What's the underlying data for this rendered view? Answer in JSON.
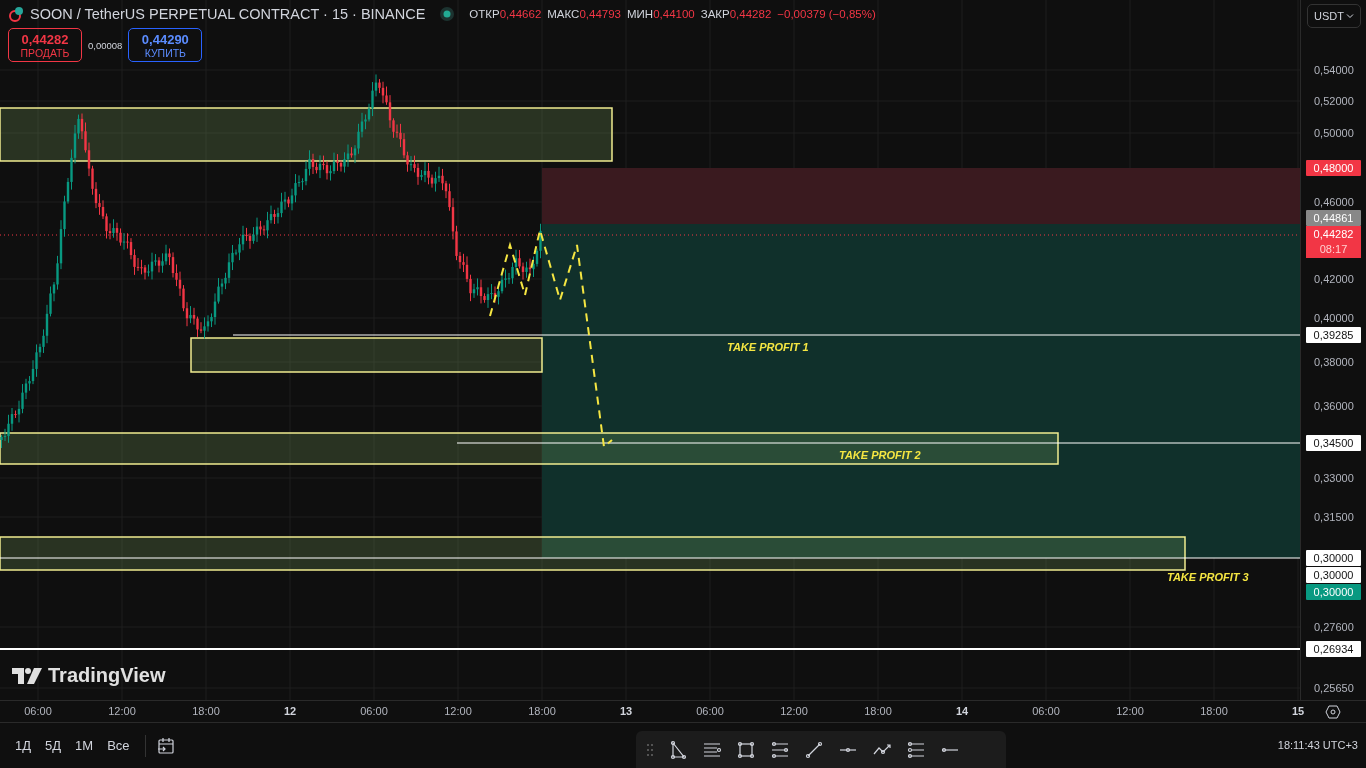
{
  "header": {
    "symbol": "SOON / TetherUS PERPETUAL CONTRACT · 15 · BINANCE",
    "ohlc": [
      {
        "label": "ОТКР",
        "value": "0,44662"
      },
      {
        "label": "МАКС",
        "value": "0,44793"
      },
      {
        "label": "МИН",
        "value": "0,44100"
      },
      {
        "label": "ЗАКР",
        "value": "0,44282"
      }
    ],
    "change": "−0,00379 (−0,85%)"
  },
  "trade": {
    "sell": {
      "price": "0,44282",
      "label": "ПРОДАТЬ"
    },
    "spread": "0,00008",
    "buy": {
      "price": "0,44290",
      "label": "КУПИТЬ"
    }
  },
  "currency": "USDT",
  "price_axis": [
    "0,54000",
    "0,52000",
    "0,50000",
    "0,46000",
    "0,42000",
    "0,40000",
    "0,38000",
    "0,36000",
    "0,33000",
    "0,31500",
    "0,27600",
    "0,25650"
  ],
  "price_tags": [
    {
      "text": "0,48000",
      "kind": "stop"
    },
    {
      "text": "0,44861",
      "kind": "entry"
    },
    {
      "text": "0,44282",
      "countdown": "08:17",
      "kind": "last"
    },
    {
      "text": "0,39285",
      "kind": "line"
    },
    {
      "text": "0,34500",
      "kind": "line"
    },
    {
      "text": "0,30000",
      "kind": "line"
    },
    {
      "text": "0,30000",
      "kind": "line"
    },
    {
      "text": "0,30000",
      "kind": "target"
    },
    {
      "text": "0,26934",
      "kind": "line"
    }
  ],
  "annotations": [
    "TAKE PROFIT 1",
    "TAKE PROFIT 2",
    "TAKE PROFIT 3"
  ],
  "logo": "TradingView",
  "time_axis": [
    {
      "text": "06:00",
      "kind": "time"
    },
    {
      "text": "12:00",
      "kind": "time"
    },
    {
      "text": "18:00",
      "kind": "time"
    },
    {
      "text": "12",
      "kind": "day"
    },
    {
      "text": "06:00",
      "kind": "time"
    },
    {
      "text": "12:00",
      "kind": "time"
    },
    {
      "text": "18:00",
      "kind": "time"
    },
    {
      "text": "13",
      "kind": "day"
    },
    {
      "text": "06:00",
      "kind": "time"
    },
    {
      "text": "12:00",
      "kind": "time"
    },
    {
      "text": "18:00",
      "kind": "time"
    },
    {
      "text": "14",
      "kind": "day"
    },
    {
      "text": "06:00",
      "kind": "time"
    },
    {
      "text": "12:00",
      "kind": "time"
    },
    {
      "text": "18:00",
      "kind": "time"
    },
    {
      "text": "15",
      "kind": "day"
    }
  ],
  "ranges": [
    "1Д",
    "5Д",
    "1М",
    "Все"
  ],
  "clock": "18:11:43 UTC+3"
}
